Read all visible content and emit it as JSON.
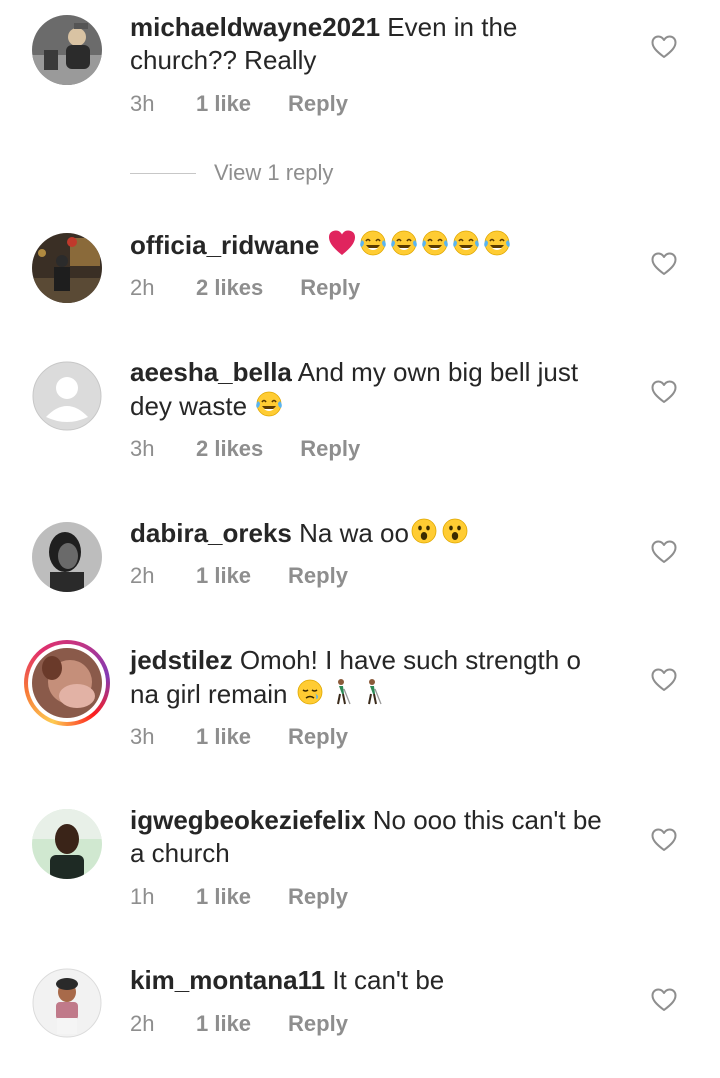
{
  "comments": [
    {
      "username": "michaeldwayne2021",
      "text_line1": "Even in the",
      "text_line2": "church?? Really",
      "time": "3h",
      "likes": "1 like",
      "reply_label": "Reply",
      "view_replies": "View 1 reply"
    },
    {
      "username": "officia_ridwane",
      "emojis": [
        "red-heart",
        "tears-of-joy",
        "tears-of-joy",
        "tears-of-joy",
        "tears-of-joy",
        "tears-of-joy"
      ],
      "time": "2h",
      "likes": "2 likes",
      "reply_label": "Reply"
    },
    {
      "username": "aeesha_bella",
      "text_line1": "And my own big bell just",
      "text_line2": "dey waste",
      "emojis": [
        "tears-of-joy"
      ],
      "time": "3h",
      "likes": "2 likes",
      "reply_label": "Reply"
    },
    {
      "username": "dabira_oreks",
      "text_line1": "Na wa oo",
      "emojis": [
        "astonished-face",
        "astonished-face"
      ],
      "time": "2h",
      "likes": "1 like",
      "reply_label": "Reply"
    },
    {
      "username": "jedstilez",
      "text_line1": "Omoh! I have such strength o",
      "text_line2": "na girl remain",
      "emojis": [
        "sleepy-face",
        "person-with-cane",
        "person-with-cane"
      ],
      "time": "3h",
      "likes": "1 like",
      "reply_label": "Reply",
      "has_story_ring": true
    },
    {
      "username": "igwegbeokeziefelix",
      "text_line1": "No ooo this can't be",
      "text_line2": "a church",
      "time": "1h",
      "likes": "1 like",
      "reply_label": "Reply"
    },
    {
      "username": "kim_montana11",
      "text_line1": "It can't be",
      "time": "2h",
      "likes": "1 like",
      "reply_label": "Reply"
    }
  ],
  "colors": {
    "text": "#262626",
    "secondary": "#8e8e8e",
    "heart_outline": "#8e8e8e",
    "red_heart": "#e0245e"
  }
}
